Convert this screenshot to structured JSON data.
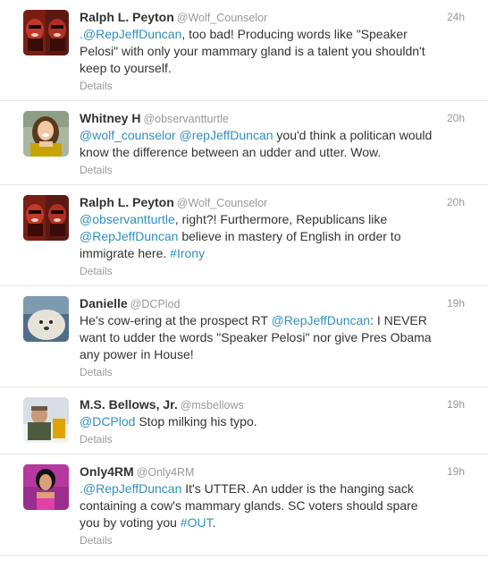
{
  "tweets": [
    {
      "fullname": "Ralph L. Peyton",
      "username": "@Wolf_Counselor",
      "time": "24h",
      "lines": [
        [
          {
            "t": "link",
            "v": ".@RepJeffDuncan"
          },
          {
            "t": "text",
            "v": ", too bad!  Producing words like \"Speaker"
          }
        ],
        [
          {
            "t": "text",
            "v": "Pelosi\" with only your mammary gland is a talent you shouldn't"
          }
        ],
        [
          {
            "t": "text",
            "v": "keep to yourself."
          }
        ]
      ],
      "details": "Details",
      "avatar": "ralph"
    },
    {
      "fullname": "Whitney H",
      "username": "@observantturtle",
      "time": "20h",
      "lines": [
        [
          {
            "t": "link",
            "v": "@wolf_counselor"
          },
          {
            "t": "text",
            "v": " "
          },
          {
            "t": "link",
            "v": "@repJeffDuncan"
          },
          {
            "t": "text",
            "v": " you'd think a politican would"
          }
        ],
        [
          {
            "t": "text",
            "v": "know the difference between an udder and utter. Wow."
          }
        ]
      ],
      "details": "Details",
      "avatar": "whitney"
    },
    {
      "fullname": "Ralph L. Peyton",
      "username": "@Wolf_Counselor",
      "time": "20h",
      "lines": [
        [
          {
            "t": "link",
            "v": "@observantturtle"
          },
          {
            "t": "text",
            "v": ", right?!  Furthermore, Republicans like"
          }
        ],
        [
          {
            "t": "link",
            "v": "@RepJeffDuncan"
          },
          {
            "t": "text",
            "v": " believe in mastery of English in order to"
          }
        ],
        [
          {
            "t": "text",
            "v": "immigrate here.  "
          },
          {
            "t": "link",
            "v": "#Irony"
          }
        ]
      ],
      "details": "Details",
      "avatar": "ralph"
    },
    {
      "fullname": "Danielle",
      "username": "@DCPlod",
      "time": "19h",
      "lines": [
        [
          {
            "t": "text",
            "v": "He's cow-ering at the prospect RT "
          },
          {
            "t": "link",
            "v": "@RepJeffDuncan"
          },
          {
            "t": "text",
            "v": ": I NEVER"
          }
        ],
        [
          {
            "t": "text",
            "v": "want to udder the words \"Speaker Pelosi\" nor give Pres Obama"
          }
        ],
        [
          {
            "t": "text",
            "v": "any power in House!"
          }
        ]
      ],
      "details": "Details",
      "avatar": "danielle"
    },
    {
      "fullname": "M.S. Bellows, Jr.",
      "username": "@msbellows",
      "time": "19h",
      "lines": [
        [
          {
            "t": "link",
            "v": "@DCPlod"
          },
          {
            "t": "text",
            "v": " Stop milking his typo."
          }
        ]
      ],
      "details": "Details",
      "avatar": "bellows"
    },
    {
      "fullname": "Only4RM",
      "username": "@Only4RM",
      "time": "19h",
      "lines": [
        [
          {
            "t": "link",
            "v": ".@RepJeffDuncan"
          },
          {
            "t": "text",
            "v": " It's UTTER. An udder is the hanging sack"
          }
        ],
        [
          {
            "t": "text",
            "v": "containing a cow's mammary glands. SC voters should spare"
          }
        ],
        [
          {
            "t": "text",
            "v": "you by voting you "
          },
          {
            "t": "link",
            "v": "#OUT"
          },
          {
            "t": "text",
            "v": "."
          }
        ]
      ],
      "details": "Details",
      "avatar": "only4rm"
    }
  ],
  "colors": {
    "link": "#2f8fbf",
    "muted": "#999999",
    "text": "#333333"
  }
}
